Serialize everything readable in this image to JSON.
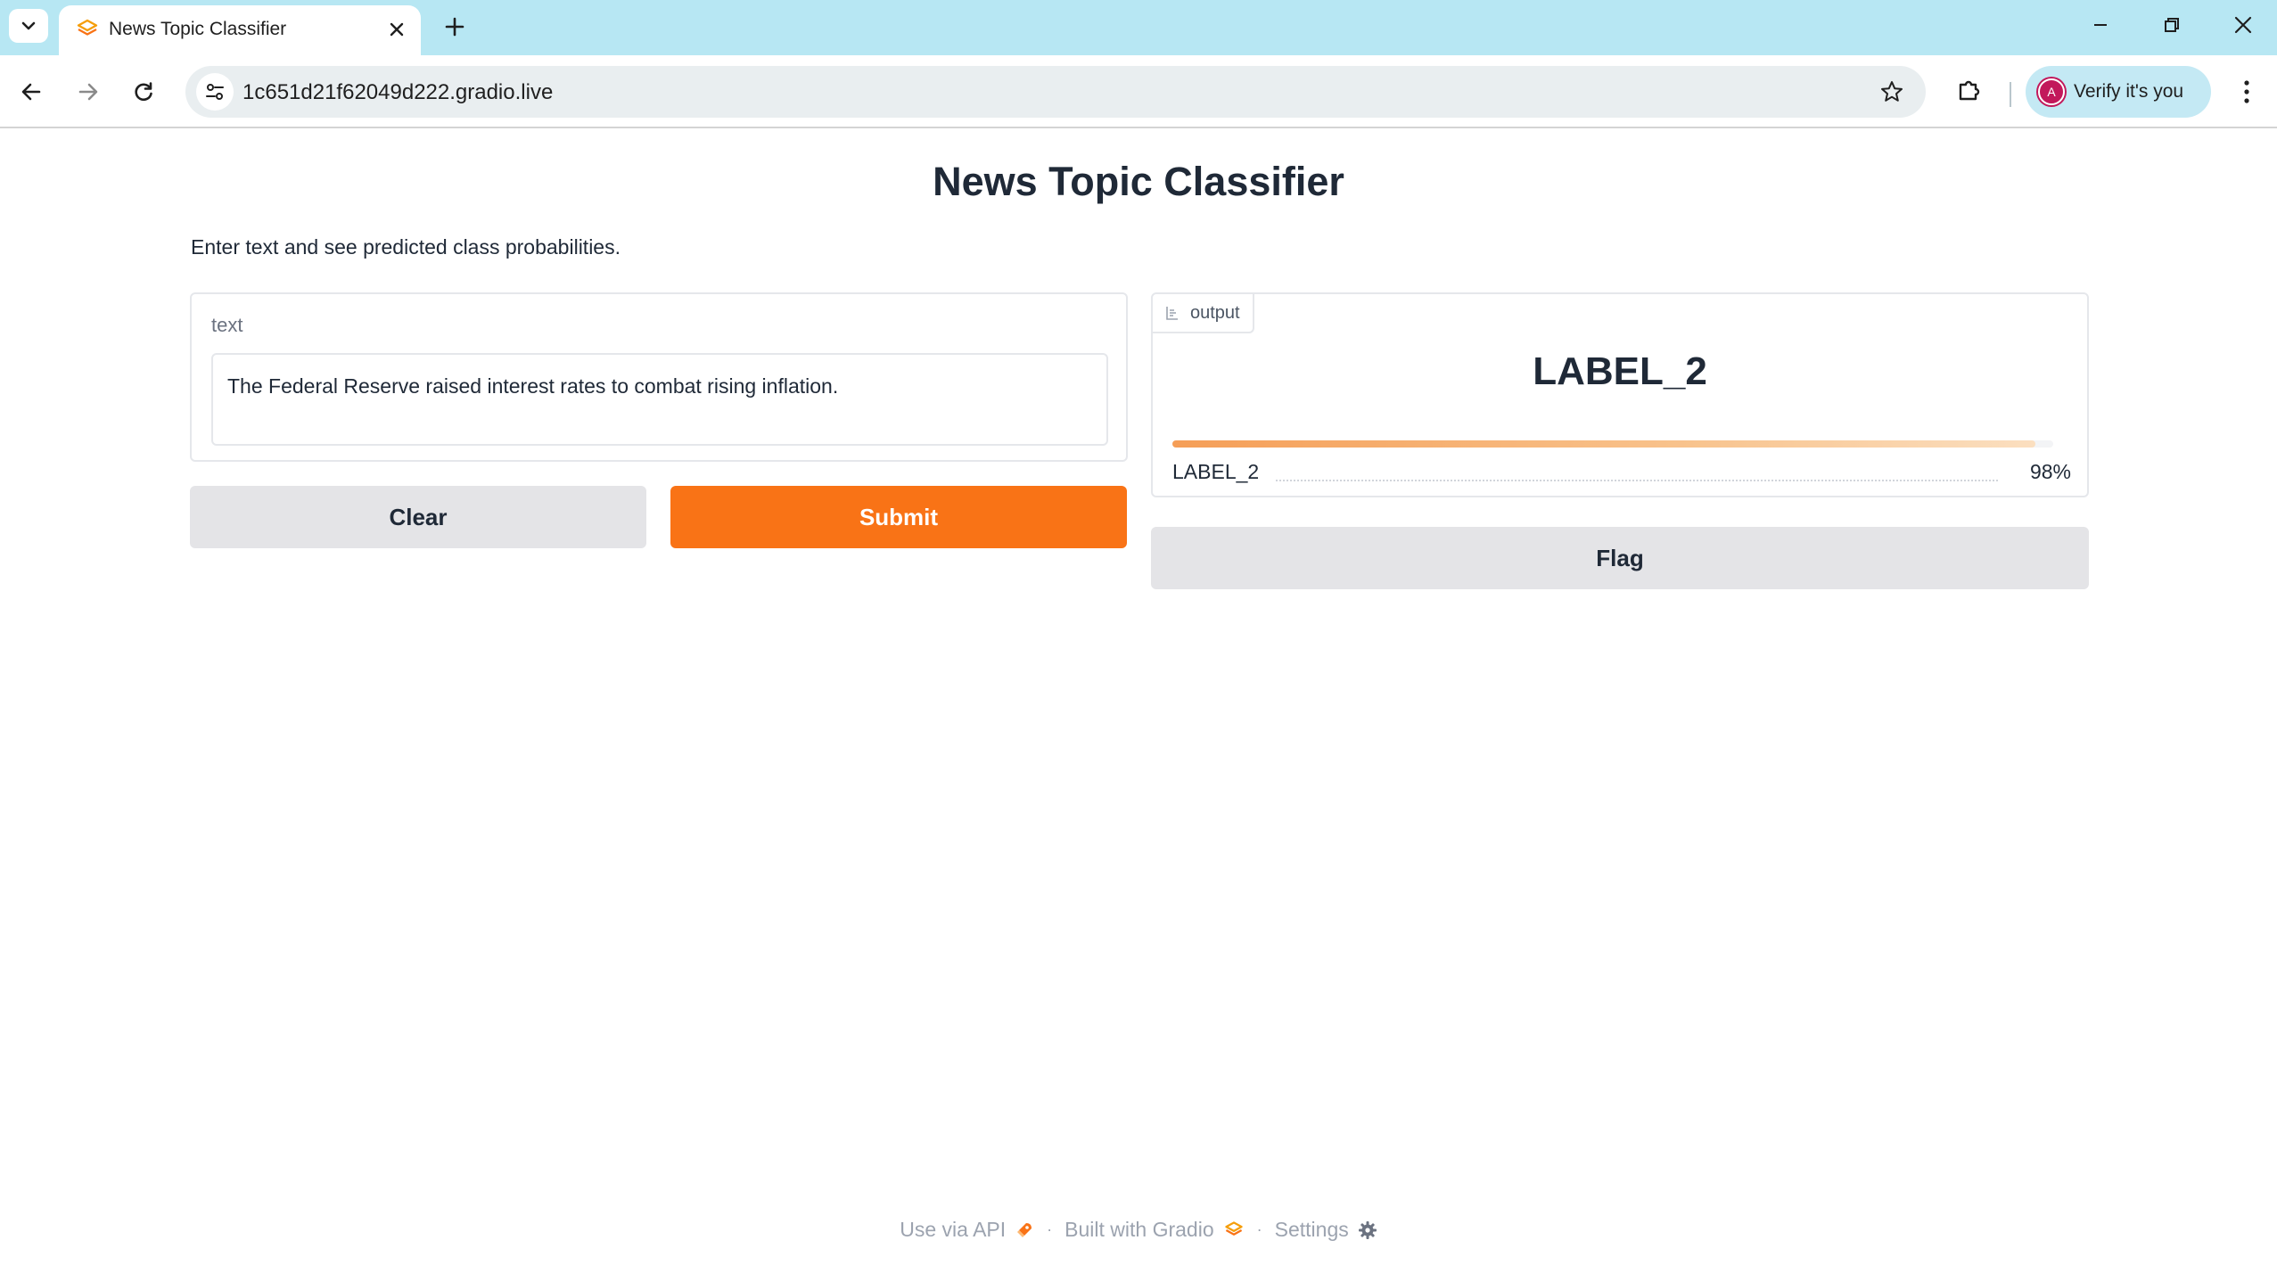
{
  "browser": {
    "tab_title": "News Topic Classifier",
    "url": "1c651d21f62049d222.gradio.live",
    "profile_label": "Verify it's you",
    "profile_initial": "A"
  },
  "page": {
    "title": "News Topic Classifier",
    "description": "Enter text and see predicted class probabilities."
  },
  "input": {
    "label": "text",
    "value": "The Federal Reserve raised interest rates to combat rising inflation."
  },
  "buttons": {
    "clear": "Clear",
    "submit": "Submit",
    "flag": "Flag"
  },
  "output": {
    "chip_label": "output",
    "predicted_label": "LABEL_2",
    "confidences": [
      {
        "label": "LABEL_2",
        "value_text": "98%",
        "fraction": 0.98
      }
    ]
  },
  "footer": {
    "api": "Use via API",
    "built": "Built with Gradio",
    "settings": "Settings"
  },
  "colors": {
    "accent": "#f97316",
    "titlebar": "#b7e7f3"
  }
}
